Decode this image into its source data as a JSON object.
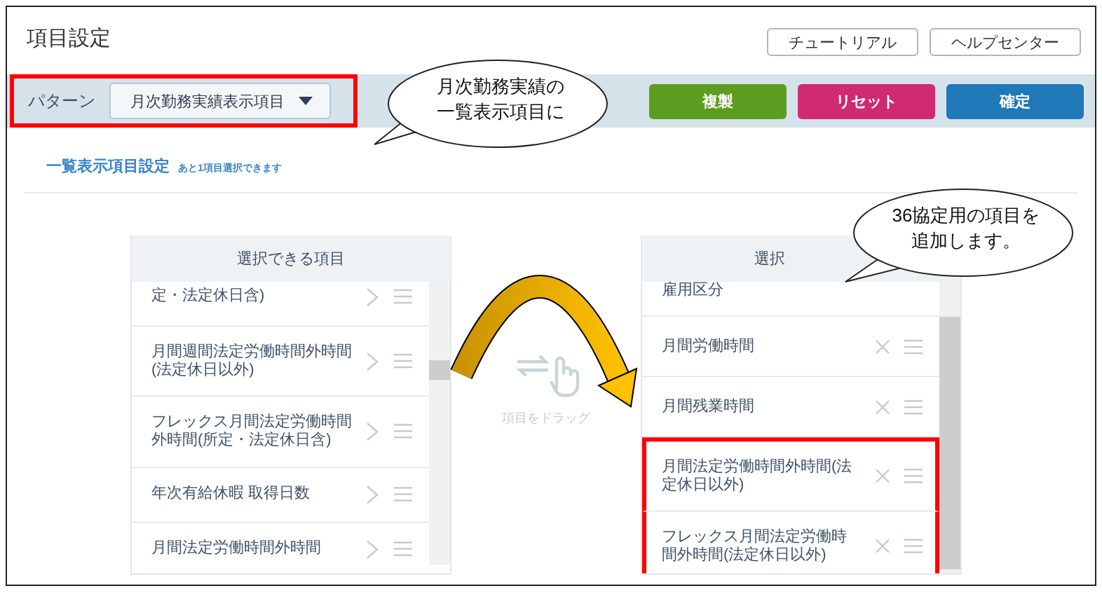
{
  "page": {
    "title": "項目設定",
    "header_buttons": [
      "チュートリアル",
      "ヘルプセンター"
    ]
  },
  "toolbar": {
    "pattern_label": "パターン",
    "pattern_value": "月次勤務実績表示項目",
    "highlighted": true,
    "actions": [
      {
        "label": "複製",
        "color": "#5c9c20"
      },
      {
        "label": "リセット",
        "color": "#cf2a72"
      },
      {
        "label": "確定",
        "color": "#1f78b8"
      }
    ]
  },
  "section": {
    "title": "一覧表示項目設定",
    "hint": "あと1項目選択できます"
  },
  "available": {
    "header": "選択できる項目",
    "items": [
      {
        "label": "定・法定休日含)"
      },
      {
        "label": "月間週間法定労働時間外時間(法定休日以外)"
      },
      {
        "label": "フレックス月間法定労働時間外時間(所定・法定休日含)"
      },
      {
        "label": "年次有給休暇 取得日数"
      },
      {
        "label": "月間法定労働時間外時間"
      }
    ]
  },
  "drag_hint": "項目をドラッグ",
  "chosen": {
    "header": "選択",
    "items": [
      {
        "label": "雇用区分",
        "kind": "cut",
        "highlighted": false
      },
      {
        "label": "月間労働時間",
        "kind": "full",
        "highlighted": false
      },
      {
        "label": "月間残業時間",
        "kind": "full",
        "highlighted": false
      },
      {
        "label": "月間法定労働時間外時間(法定休日以外)",
        "kind": "full",
        "highlighted": true
      },
      {
        "label": "フレックス月間法定労働時間外時間(法定休日以外)",
        "kind": "full",
        "highlighted": true
      }
    ]
  },
  "callouts": [
    {
      "lines": [
        "月次勤務実績の",
        "一覧表示項目に"
      ]
    },
    {
      "lines": [
        "36協定用の項目を",
        "追加します。"
      ]
    }
  ]
}
